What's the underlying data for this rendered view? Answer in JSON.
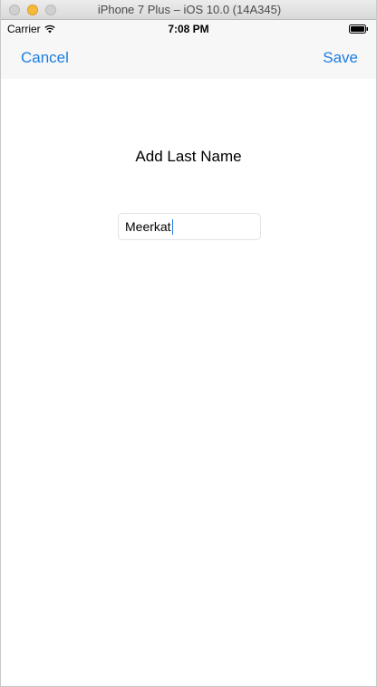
{
  "window": {
    "title": "iPhone 7 Plus – iOS 10.0 (14A345)"
  },
  "status_bar": {
    "carrier": "Carrier",
    "time": "7:08 PM"
  },
  "nav_bar": {
    "cancel_label": "Cancel",
    "save_label": "Save",
    "tint_color": "#1a7ddf"
  },
  "form": {
    "heading": "Add Last Name",
    "last_name_value": "Meerkat"
  }
}
